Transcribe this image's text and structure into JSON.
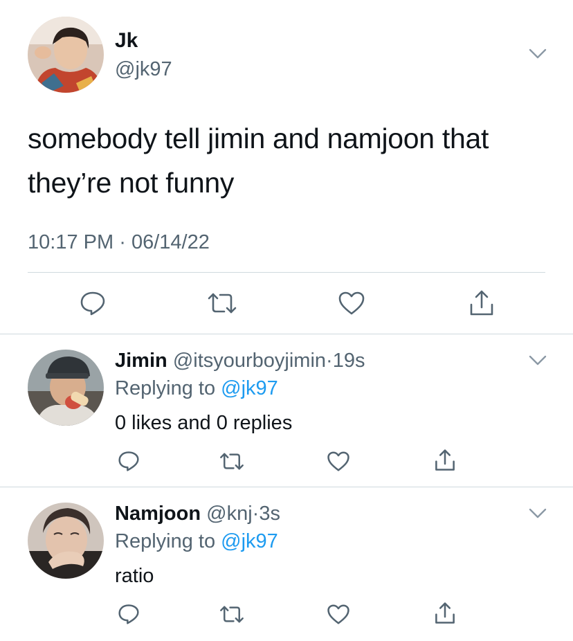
{
  "main_tweet": {
    "name": "Jk",
    "handle": "@jk97",
    "text": "somebody tell jimin and namjoon that they’re not funny",
    "time": "10:17 PM",
    "separator": "·",
    "date": "06/14/22",
    "avatar_icon": "user-photo",
    "more_icon": "chevron-down-icon",
    "actions": [
      "reply-icon",
      "retweet-icon",
      "like-icon",
      "share-icon"
    ]
  },
  "replies": [
    {
      "name": "Jimin",
      "handle": "@itsyourboyjimin",
      "separator": "·",
      "time_ago": "19s",
      "replying_prefix": "Replying to",
      "replying_handle": "@jk97",
      "text": "0 likes and 0 replies"
    },
    {
      "name": "Namjoon",
      "handle": "@knj",
      "separator": "·",
      "time_ago": "3s",
      "replying_prefix": "Replying to",
      "replying_handle": "@jk97",
      "text": "ratio"
    }
  ],
  "colors": {
    "text": "#0f1419",
    "muted": "#536471",
    "link": "#1d9bf0",
    "divider": "#cfd9de",
    "icon": "#536471"
  }
}
